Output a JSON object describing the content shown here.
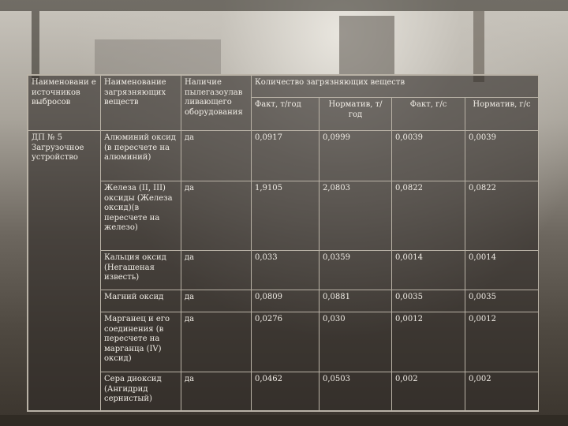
{
  "table": {
    "headers": {
      "source_name": "Наименовани е источников выбросов",
      "pollutant_name": "Наименование загрязняющих веществ",
      "gas_cleaning": "Наличие пылегазоулав ливающего оборудования",
      "quantity_group": "Количество загрязняющих веществ",
      "fact_t_year": "Факт, т/год",
      "norm_t_year": "Норматив, т/год",
      "fact_g_s": "Факт, г/с",
      "norm_g_s": "Норматив, г/с"
    },
    "source": "ДП № 5 Загрузочное устройство",
    "rows": [
      {
        "pollutant": "Алюминий оксид (в пересчете на алюминий)",
        "gas_cleaning": "да",
        "fact_t_year": "0,0917",
        "norm_t_year": "0,0999",
        "fact_g_s": "0,0039",
        "norm_g_s": "0,0039"
      },
      {
        "pollutant": "Железа (II, III) оксиды (Железа оксид)(в пересчете на железо)",
        "gas_cleaning": "да",
        "fact_t_year": "1,9105",
        "norm_t_year": "2,0803",
        "fact_g_s": "0,0822",
        "norm_g_s": "0,0822"
      },
      {
        "pollutant": "Кальция оксид (Негашеная известь)",
        "gas_cleaning": "да",
        "fact_t_year": "0,033",
        "norm_t_year": "0,0359",
        "fact_g_s": "0,0014",
        "norm_g_s": "0,0014"
      },
      {
        "pollutant": "Магний оксид",
        "gas_cleaning": "да",
        "fact_t_year": "0,0809",
        "norm_t_year": "0,0881",
        "fact_g_s": "0,0035",
        "norm_g_s": "0,0035"
      },
      {
        "pollutant": "Марганец и его соединения (в пересчете на марганца (IV) оксид)",
        "gas_cleaning": "да",
        "fact_t_year": "0,0276",
        "norm_t_year": "0,030",
        "fact_g_s": "0,0012",
        "norm_g_s": "0,0012"
      },
      {
        "pollutant": "Сера диоксид (Ангидрид сернистый)",
        "gas_cleaning": "да",
        "fact_t_year": "0,0462",
        "norm_t_year": "0,0503",
        "fact_g_s": "0,002",
        "norm_g_s": "0,002"
      }
    ]
  }
}
